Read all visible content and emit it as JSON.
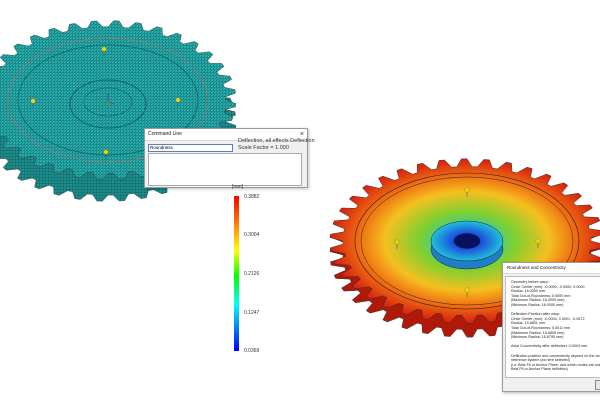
{
  "command_dialog": {
    "title": "Command Line",
    "close_glyph": "×",
    "input_value": "Roundness",
    "output_text": ""
  },
  "deflection_info": {
    "line1": "Deflection, all effects Deflection",
    "line2": "Scale Factor = 1.000"
  },
  "legend": {
    "unit": "[mm]",
    "labels": [
      "0.3882",
      "0.3004",
      "0.2126",
      "0.1247",
      "0.0369"
    ],
    "colors": [
      "#ff0000",
      "#ff8000",
      "#ffff00",
      "#00ff00",
      "#00ffff",
      "#0080ff",
      "#0000ff"
    ]
  },
  "roundness_dialog": {
    "title": "Roundness and Concentricity",
    "lines": [
      "Geometry before warp:",
      "Circle Center (mm): -0.0000, -0.0000, 0.0000",
      "Radius: 16.0000 mm",
      "Total Out-of-Roundness: 0.0000 mm",
      "(Maximum Radius: 16.0000 mm)",
      "(Minimum Radius: 16.0000 mm)",
      "",
      "Deflection Position after warp:",
      "Circle Center (mm): -0.0004, 0.0001, -0.0672",
      "Radius: 15.6801 mm",
      "Total Out-of-Roundness: 0.0011 mm",
      "(Maximum Radius: 15.6806 mm)",
      "(Minimum Radius: 15.6795 mm)",
      "",
      "Axial Concentricity after deflection: 0.0004 mm",
      "",
      "Deflection position and concentricity depend on the chosen",
      "reference system (as here selected)",
      "(i.e. Best Fit or Anchor Plane, and which nodes are used for",
      "Best Fit or Anchor Plane definition)"
    ],
    "ok_label": ""
  },
  "viewport": {
    "background": "#ffffff",
    "mesh_color": "#1fb8b8",
    "mesh_line_color": "#2a2a2a",
    "marker_color": "#e6d21a",
    "anchor_color": "#d83a3a",
    "right_gear_colors": [
      "#d51f10",
      "#ef6a10",
      "#f4c020",
      "#7ed030",
      "#22c8c8",
      "#1a40d0"
    ]
  }
}
